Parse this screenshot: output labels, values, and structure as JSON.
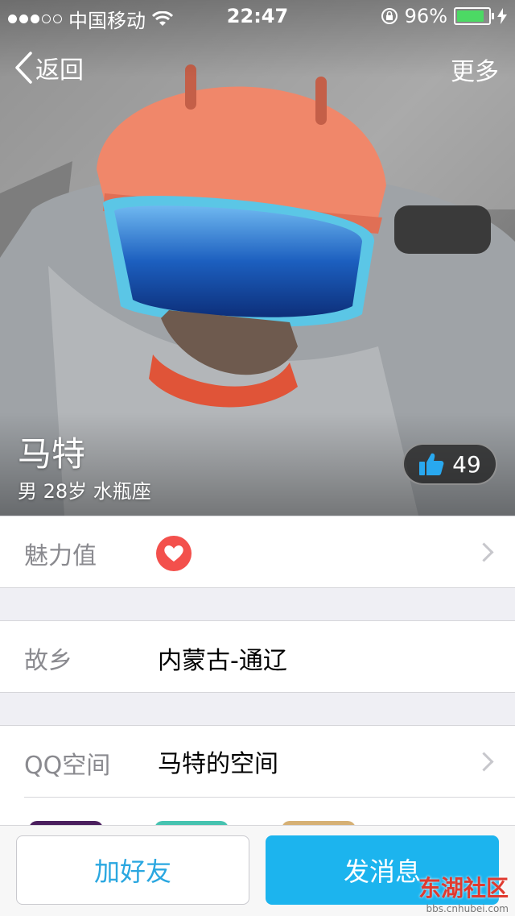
{
  "status_bar": {
    "carrier": "中国移动",
    "time": "22:47",
    "battery_percent": "96%",
    "battery_level": 0.96,
    "signal_dots_filled": 3,
    "signal_dots_total": 5
  },
  "nav": {
    "back_label": "返回",
    "more_label": "更多"
  },
  "profile": {
    "name": "马特",
    "details": "男 28岁 水瓶座",
    "likes": "49"
  },
  "rows": {
    "charm_label": "魅力值",
    "hometown_label": "故乡",
    "hometown_value": "内蒙古-通辽",
    "qzone_label": "QQ空间",
    "qzone_value": "马特的空间"
  },
  "actions": {
    "add_friend": "加好友",
    "send_message": "发消息"
  },
  "watermark": {
    "name": "东湖社区",
    "url": "bbs.cnhubei.com"
  },
  "colors": {
    "accent": "#1cb4ee",
    "heart": "#f3504c",
    "battery": "#4cd964"
  }
}
